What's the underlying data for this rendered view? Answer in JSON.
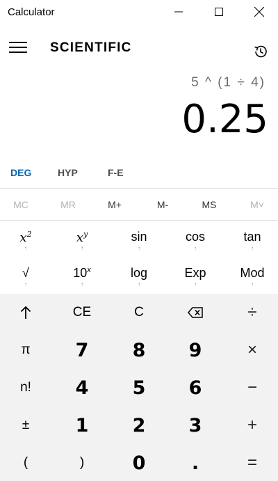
{
  "window": {
    "title": "Calculator"
  },
  "header": {
    "mode": "SCIENTIFIC"
  },
  "display": {
    "expression": "5 ^ (1 ÷ 4)",
    "value": "0.25"
  },
  "angle_row": {
    "items": [
      "DEG",
      "HYP",
      "F-E"
    ],
    "active": "DEG"
  },
  "memory_row": {
    "items": [
      "MC",
      "MR",
      "M+",
      "M-",
      "MS",
      "M˅"
    ]
  },
  "scientific": {
    "row1": [
      {
        "label": "x",
        "sup": "2",
        "arrow": "↑"
      },
      {
        "label": "x",
        "sup": "y",
        "arrow": "↑"
      },
      {
        "label": "sin",
        "arrow": "↑"
      },
      {
        "label": "cos",
        "arrow": "↑"
      },
      {
        "label": "tan",
        "arrow": "↑"
      }
    ],
    "row2": [
      {
        "label": "√",
        "arrow": "↑"
      },
      {
        "label": "10",
        "sup": "x",
        "arrow": "↑"
      },
      {
        "label": "log",
        "arrow": "↑"
      },
      {
        "label": "Exp",
        "arrow": "↑"
      },
      {
        "label": "Mod",
        "arrow": "↑"
      }
    ]
  },
  "keypad": {
    "rows": [
      [
        "↑",
        "CE",
        "C",
        "⌫",
        "÷"
      ],
      [
        "π",
        "7",
        "8",
        "9",
        "×"
      ],
      [
        "n!",
        "4",
        "5",
        "6",
        "−"
      ],
      [
        "±",
        "1",
        "2",
        "3",
        "+"
      ],
      [
        "(",
        ")",
        "0",
        ".",
        "="
      ]
    ]
  },
  "colors": {
    "accent": "#0063b1",
    "keypad_bg": "#f2f2f2",
    "disabled": "#b3b3b3"
  }
}
